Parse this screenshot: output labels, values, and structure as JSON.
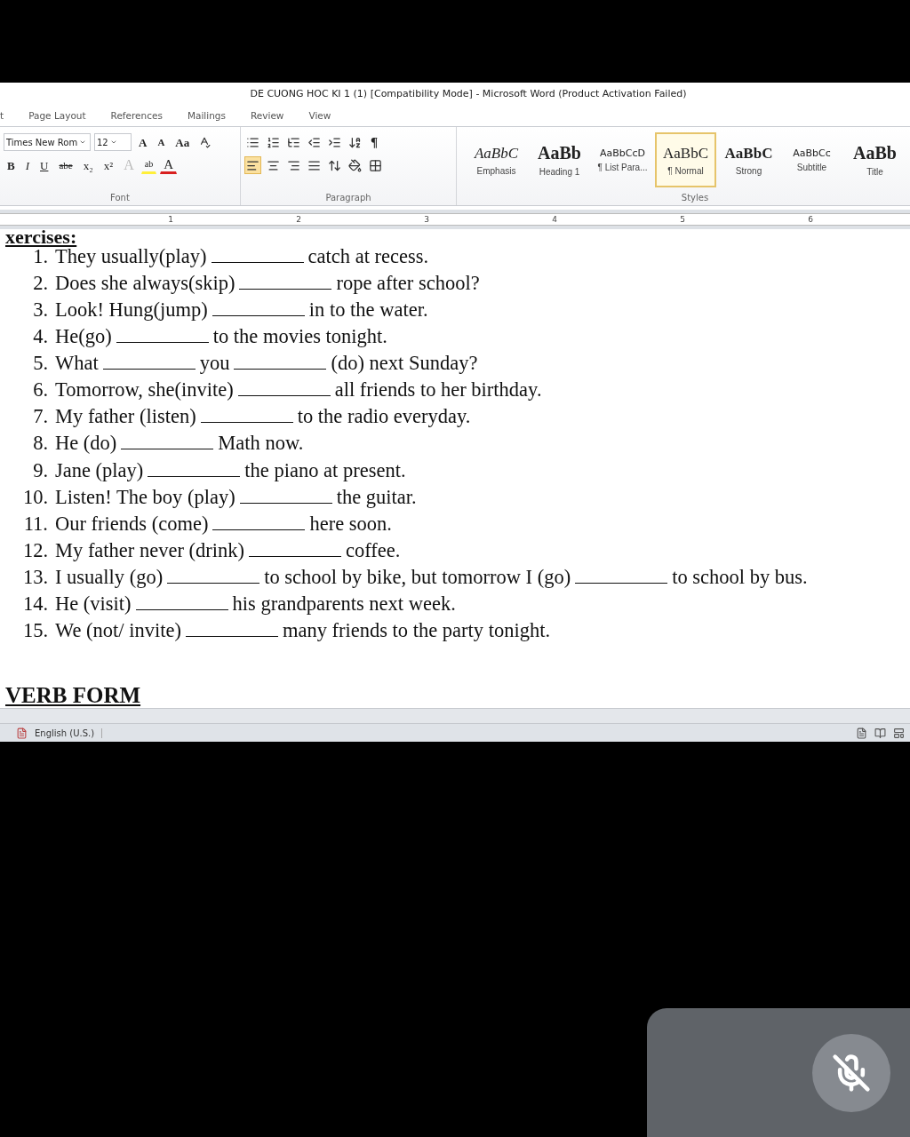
{
  "title": "DE CUONG HOC KI 1 (1) [Compatibility Mode] - Microsoft Word (Product Activation Failed)",
  "tabs": [
    {
      "label": "t",
      "selected": false
    },
    {
      "label": "Page Layout",
      "selected": false
    },
    {
      "label": "References",
      "selected": false
    },
    {
      "label": "Mailings",
      "selected": false
    },
    {
      "label": "Review",
      "selected": false
    },
    {
      "label": "View",
      "selected": false
    }
  ],
  "font_group": {
    "label": "Font",
    "font_name": "Times New Rom",
    "font_size": "12",
    "top_buttons": [
      {
        "kind": "grow",
        "text": "A"
      },
      {
        "kind": "shrink",
        "text": "A"
      },
      {
        "kind": "case",
        "text": "Aa"
      }
    ],
    "bottom_buttons": [
      {
        "kind": "bold",
        "text": "B"
      },
      {
        "kind": "italic",
        "text": "I"
      },
      {
        "kind": "underline",
        "text": "U"
      },
      {
        "kind": "strike",
        "text": "abe"
      },
      {
        "kind": "sub",
        "text": "x₂"
      },
      {
        "kind": "super",
        "text": "x²"
      },
      {
        "kind": "effects",
        "text": "A"
      },
      {
        "kind": "highlight",
        "text": "ab"
      },
      {
        "kind": "color",
        "text": "A"
      }
    ]
  },
  "paragraph_group": {
    "label": "Paragraph",
    "pilcrow": "¶",
    "alignments": [
      {
        "kind": "left",
        "selected": true
      },
      {
        "kind": "center",
        "selected": false
      },
      {
        "kind": "right",
        "selected": false
      },
      {
        "kind": "justify",
        "selected": false
      }
    ]
  },
  "styles_group": {
    "label": "Styles",
    "items": [
      {
        "kind": "emphasis",
        "preview": "AaBbC",
        "label": "Emphasis",
        "selected": false
      },
      {
        "kind": "heading",
        "preview": "AaBb",
        "label": "Heading 1",
        "selected": false
      },
      {
        "kind": "small",
        "preview": "AaBbCcD",
        "label": "¶ List Para...",
        "selected": false
      },
      {
        "kind": "normal",
        "preview": "AaBbC",
        "label": "¶ Normal",
        "selected": true
      },
      {
        "kind": "strong",
        "preview": "AaBbC",
        "label": "Strong",
        "selected": false
      },
      {
        "kind": "small",
        "preview": "AaBbCc",
        "label": "Subtitle",
        "selected": false
      },
      {
        "kind": "heading",
        "preview": "AaBb",
        "label": "Title",
        "selected": false
      }
    ]
  },
  "ruler": {
    "numbers": [
      "1",
      "2",
      "3",
      "4",
      "5",
      "6"
    ]
  },
  "document": {
    "heading": "xercises:",
    "items": [
      {
        "number": "1.",
        "parts": [
          {
            "kind": "text",
            "text": "They usually(play)"
          },
          {
            "kind": "blank"
          },
          {
            "kind": "text",
            "text": "catch at recess."
          }
        ]
      },
      {
        "number": "2.",
        "parts": [
          {
            "kind": "text",
            "text": "Does she always(skip)"
          },
          {
            "kind": "blank"
          },
          {
            "kind": "text",
            "text": "rope after school?"
          }
        ]
      },
      {
        "number": "3.",
        "parts": [
          {
            "kind": "text",
            "text": "Look! Hung(jump)"
          },
          {
            "kind": "blank"
          },
          {
            "kind": "text",
            "text": "in to the water."
          }
        ]
      },
      {
        "number": "4.",
        "parts": [
          {
            "kind": "text",
            "text": "He(go)"
          },
          {
            "kind": "blank"
          },
          {
            "kind": "text",
            "text": "to the movies tonight."
          }
        ]
      },
      {
        "number": "5.",
        "parts": [
          {
            "kind": "text",
            "text": "What"
          },
          {
            "kind": "blank"
          },
          {
            "kind": "text",
            "text": "you"
          },
          {
            "kind": "blank"
          },
          {
            "kind": "text",
            "text": "(do) next Sunday?"
          }
        ]
      },
      {
        "number": "6.",
        "parts": [
          {
            "kind": "text",
            "text": "Tomorrow, she(invite)"
          },
          {
            "kind": "blank"
          },
          {
            "kind": "text",
            "text": "all friends to her birthday."
          }
        ]
      },
      {
        "number": "7.",
        "parts": [
          {
            "kind": "text",
            "text": "My father (listen)"
          },
          {
            "kind": "blank"
          },
          {
            "kind": "text",
            "text": "to the radio everyday."
          }
        ]
      },
      {
        "number": "8.",
        "parts": [
          {
            "kind": "text",
            "text": "He (do)"
          },
          {
            "kind": "blank"
          },
          {
            "kind": "text",
            "text": "Math now."
          }
        ]
      },
      {
        "number": "9.",
        "parts": [
          {
            "kind": "text",
            "text": "Jane (play)"
          },
          {
            "kind": "blank"
          },
          {
            "kind": "text",
            "text": "the piano at present."
          }
        ]
      },
      {
        "number": "10.",
        "parts": [
          {
            "kind": "text",
            "text": "Listen! The boy (play)"
          },
          {
            "kind": "blank"
          },
          {
            "kind": "text",
            "text": "the guitar."
          }
        ]
      },
      {
        "number": "11.",
        "parts": [
          {
            "kind": "text",
            "text": "Our friends (come)"
          },
          {
            "kind": "blank"
          },
          {
            "kind": "text",
            "text": "here soon."
          }
        ]
      },
      {
        "number": "12.",
        "parts": [
          {
            "kind": "text",
            "text": "My father never (drink)"
          },
          {
            "kind": "blank"
          },
          {
            "kind": "text",
            "text": "coffee."
          }
        ]
      },
      {
        "number": "13.",
        "parts": [
          {
            "kind": "text",
            "text": "I usually (go)"
          },
          {
            "kind": "blank"
          },
          {
            "kind": "text",
            "text": "to school by bike, but tomorrow I (go)"
          },
          {
            "kind": "blank"
          },
          {
            "kind": "text",
            "text": "to school by bus."
          }
        ]
      },
      {
        "number": "14.",
        "parts": [
          {
            "kind": "text",
            "text": "He (visit)"
          },
          {
            "kind": "blank"
          },
          {
            "kind": "text",
            "text": "his grandparents next week."
          }
        ]
      },
      {
        "number": "15.",
        "parts": [
          {
            "kind": "text",
            "text": "We (not/ invite)"
          },
          {
            "kind": "blank"
          },
          {
            "kind": "text",
            "text": "many friends to the party tonight."
          }
        ]
      }
    ],
    "section_title": "VERB FORM"
  },
  "status_bar": {
    "language": "English (U.S.)"
  },
  "video_tile": {
    "muted": true
  }
}
